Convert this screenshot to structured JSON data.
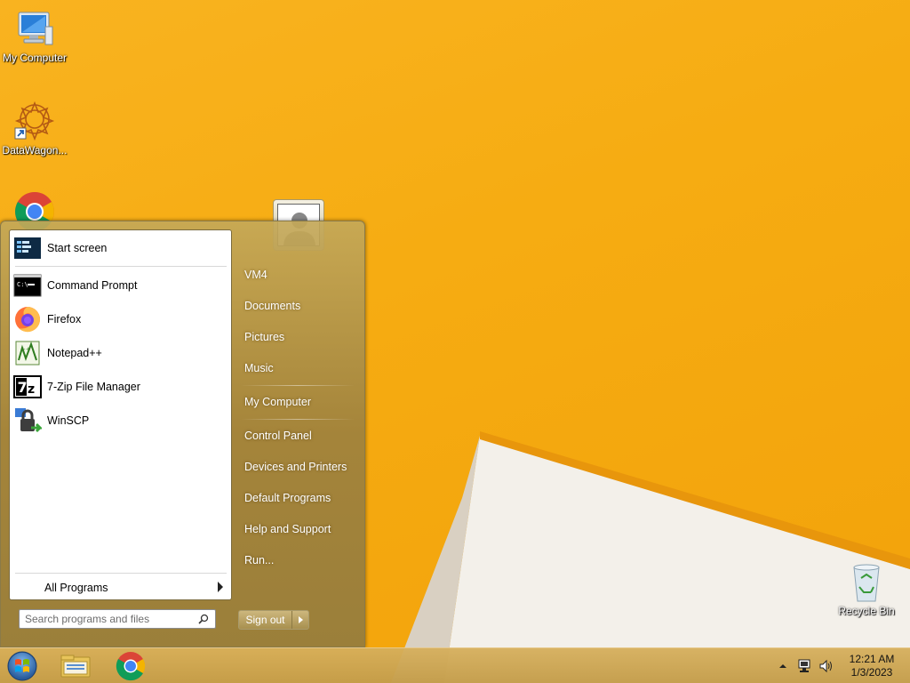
{
  "desktop": {
    "icons": [
      {
        "label": "My Computer",
        "icon": "computer-icon"
      },
      {
        "label": "DataWagon...",
        "icon": "datawagon-icon"
      },
      {
        "label": "",
        "icon": "chrome-icon"
      },
      {
        "label": "Recycle Bin",
        "icon": "recycle-bin-icon"
      }
    ]
  },
  "start_menu": {
    "programs": [
      {
        "label": "Start screen",
        "icon": "start-screen-icon"
      },
      {
        "label": "Command Prompt",
        "icon": "command-prompt-icon"
      },
      {
        "label": "Firefox",
        "icon": "firefox-icon"
      },
      {
        "label": "Notepad++",
        "icon": "notepadpp-icon"
      },
      {
        "label": "7-Zip File Manager",
        "icon": "7zip-icon"
      },
      {
        "label": "WinSCP",
        "icon": "winscp-icon"
      }
    ],
    "all_programs": "All Programs",
    "search_placeholder": "Search programs and files",
    "right_items": [
      {
        "label": "VM4"
      },
      {
        "label": "Documents"
      },
      {
        "label": "Pictures"
      },
      {
        "label": "Music"
      },
      {
        "label": "My Computer"
      },
      {
        "label": "Control Panel"
      },
      {
        "label": "Devices and Printers"
      },
      {
        "label": "Default Programs"
      },
      {
        "label": "Help and Support"
      },
      {
        "label": "Run..."
      }
    ],
    "sign_out": "Sign out"
  },
  "taskbar": {
    "pinned": [
      {
        "icon": "start-orb-icon"
      },
      {
        "icon": "file-explorer-icon"
      },
      {
        "icon": "chrome-icon"
      }
    ],
    "tray_icons": [
      "chevron-up-icon",
      "network-icon",
      "volume-icon"
    ],
    "time": "12:21 AM",
    "date": "1/3/2023"
  },
  "colors": {
    "wallpaper": "#f6ac12",
    "start_menu_glass": "#a88c4c",
    "taskbar": "#c99f4c"
  }
}
